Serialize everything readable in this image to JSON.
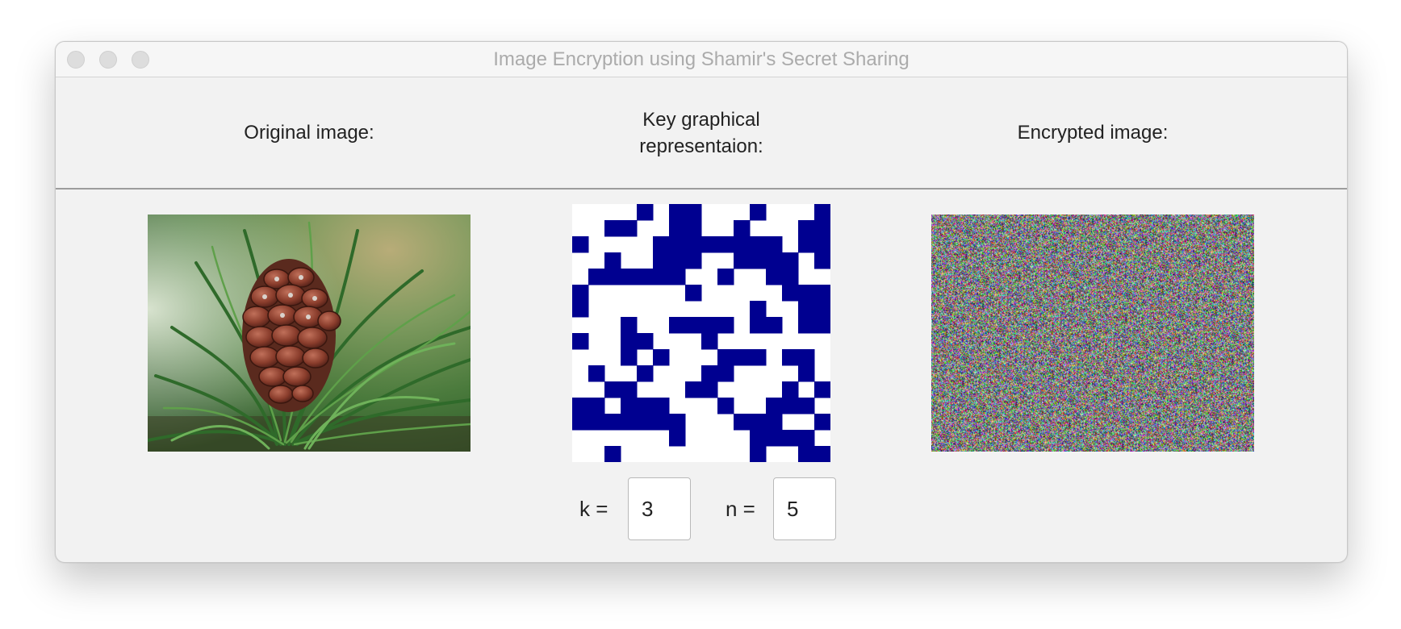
{
  "window": {
    "title": "Image Encryption using Shamir's Secret Sharing"
  },
  "labels": {
    "original": "Original image:",
    "key_line1": "Key graphical",
    "key_line2": "representaion:",
    "encrypted": "Encrypted image:"
  },
  "params": {
    "k_label": "k =",
    "k_value": "3",
    "n_label": "n =",
    "n_value": "5"
  },
  "key_pattern": {
    "color_on": "#000090",
    "color_off": "#ffffff",
    "rows": [
      "0000101100010001",
      "0011001100100011",
      "1000011111111011",
      "0010011100111101",
      "0111111001001100",
      "1000000100000111",
      "1000000000010011",
      "0001001111011011",
      "1001100010000000",
      "0001010001110110",
      "0100100011000010",
      "0011000110000101",
      "1101110001001110",
      "1111111000111001",
      "0000001000011110",
      "0010000000010011"
    ]
  },
  "images": {
    "original_alt": "pine-cone-photo",
    "encrypted_alt": "encrypted-noise"
  }
}
